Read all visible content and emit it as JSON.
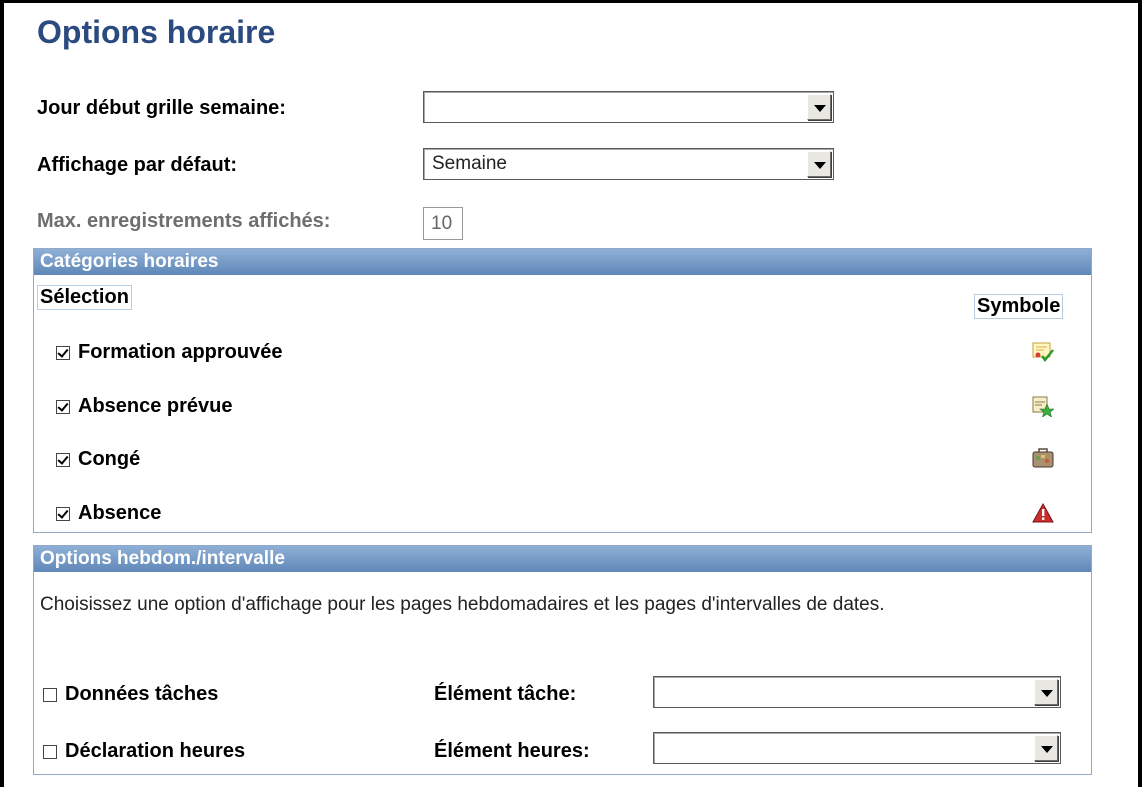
{
  "page": {
    "title": "Options horaire"
  },
  "fields": {
    "jour_debut": {
      "label": "Jour début grille semaine:",
      "value": ""
    },
    "affichage": {
      "label": "Affichage par défaut:",
      "value": "Semaine"
    },
    "max_enreg": {
      "label": "Max. enregistrements affichés:",
      "value": "10"
    }
  },
  "categories": {
    "header": "Catégories horaires",
    "col_selection": "Sélection",
    "col_symbole": "Symbole",
    "items": [
      {
        "label": "Formation approuvée",
        "checked": true,
        "icon": "certificate-approved-icon"
      },
      {
        "label": "Absence prévue",
        "checked": true,
        "icon": "calendar-star-icon"
      },
      {
        "label": "Congé",
        "checked": true,
        "icon": "suitcase-icon"
      },
      {
        "label": "Absence",
        "checked": true,
        "icon": "warning-triangle-icon"
      }
    ]
  },
  "weekly": {
    "header": "Options hebdom./intervalle",
    "description": "Choisissez une option d'affichage pour les pages hebdomadaires et les pages d'intervalles de dates.",
    "donnees_taches": {
      "label": "Données tâches",
      "checked": false
    },
    "declaration_heures": {
      "label": "Déclaration heures",
      "checked": false
    },
    "element_tache": {
      "label": "Élément tâche:",
      "value": ""
    },
    "element_heures": {
      "label": "Élément heures:",
      "value": ""
    }
  },
  "colors": {
    "title": "#2b4a7f",
    "section_header": "#6f93c2",
    "border": "#8fa9c8"
  }
}
